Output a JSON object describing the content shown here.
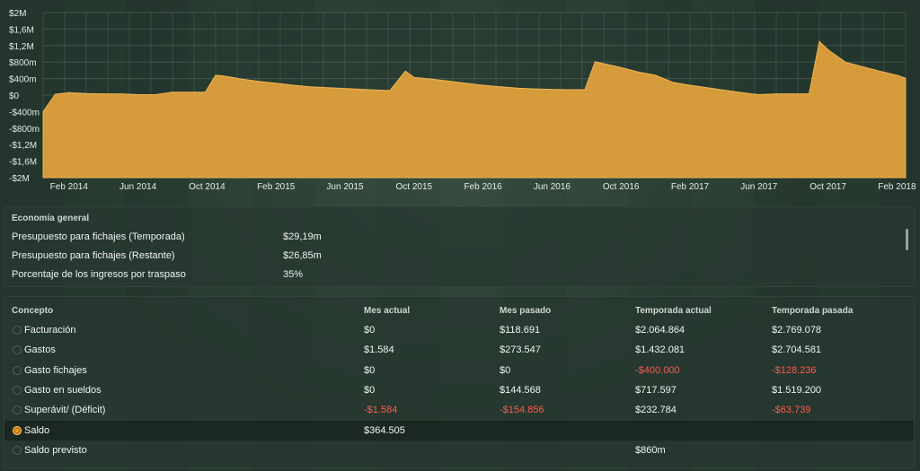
{
  "chart_data": {
    "type": "area",
    "y_ticks": [
      "$2M",
      "$1,6M",
      "$1,2M",
      "$800m",
      "$400m",
      "$0",
      "-$400m",
      "-$800m",
      "-$1,2M",
      "-$1,6M",
      "-$2M"
    ],
    "ylim": [
      -2000000,
      2000000
    ],
    "x_tick_labels": [
      "Feb 2014",
      "Jun 2014",
      "Oct 2014",
      "Feb 2015",
      "Jun 2015",
      "Oct 2015",
      "Feb 2016",
      "Jun 2016",
      "Oct 2016",
      "Feb 2017",
      "Jun 2017",
      "Oct 2017",
      "Feb 2018"
    ],
    "x_tick_months": [
      1,
      5,
      9,
      13,
      17,
      21,
      25,
      29,
      33,
      37,
      41,
      45,
      49
    ],
    "x_range_months": [
      -0.5,
      49.5
    ],
    "grid": true,
    "fill_color": "#e3a23c",
    "x_months": [
      -0.5,
      0.2,
      1,
      2,
      3,
      4,
      5,
      6,
      7,
      8,
      8.9,
      9.5,
      10,
      11,
      12,
      13,
      14,
      15,
      16,
      17,
      18,
      19,
      19.6,
      20.5,
      21,
      22,
      23,
      24,
      25,
      26,
      27,
      28,
      29,
      30,
      30.9,
      31.5,
      32,
      33,
      34,
      35,
      36,
      37,
      38,
      39,
      40,
      41,
      42,
      43,
      43.9,
      44.5,
      45,
      46,
      47,
      48,
      49,
      49.5
    ],
    "values": [
      -400000,
      20000,
      60000,
      40000,
      30000,
      30000,
      10000,
      10000,
      70000,
      70000,
      70000,
      480000,
      460000,
      390000,
      330000,
      290000,
      240000,
      200000,
      180000,
      160000,
      140000,
      120000,
      110000,
      580000,
      430000,
      390000,
      340000,
      290000,
      240000,
      200000,
      170000,
      150000,
      140000,
      130000,
      130000,
      810000,
      760000,
      670000,
      560000,
      480000,
      310000,
      240000,
      180000,
      120000,
      60000,
      10000,
      30000,
      30000,
      30000,
      1300000,
      1100000,
      800000,
      690000,
      580000,
      480000,
      410000
    ]
  },
  "economy": {
    "title": "Economía general",
    "rows": [
      {
        "label": "Presupuesto para fichajes (Temporada)",
        "value": "$29,19m"
      },
      {
        "label": "Presupuesto para fichajes (Restante)",
        "value": "$26,85m"
      },
      {
        "label": "Porcentaje de los ingresos por traspaso",
        "value": "35%"
      }
    ]
  },
  "finance": {
    "headers": {
      "concept": "Concepto",
      "current_month": "Mes actual",
      "last_month": "Mes pasado",
      "current_season": "Temporada actual",
      "last_season": "Temporada pasada"
    },
    "rows": [
      {
        "concept": "Facturación",
        "current_month": "$0",
        "last_month": "$118.691",
        "current_season": "$2.064.864",
        "last_season": "$2.769.078"
      },
      {
        "concept": "Gastos",
        "current_month": "$1.584",
        "last_month": "$273.547",
        "current_season": "$1.432.081",
        "last_season": "$2.704.581"
      },
      {
        "concept": "Gasto fichajes",
        "current_month": "$0",
        "last_month": "$0",
        "current_season": "-$400.000",
        "last_season": "-$128.236"
      },
      {
        "concept": "Gasto en sueldos",
        "current_month": "$0",
        "last_month": "$144.568",
        "current_season": "$717.597",
        "last_season": "$1.519.200"
      },
      {
        "concept": "Superávit/ (Déficit)",
        "current_month": "-$1.584",
        "last_month": "-$154.856",
        "current_season": "$232.784",
        "last_season": "-$63.739"
      },
      {
        "concept": "Saldo",
        "current_month": "$364.505",
        "last_month": "",
        "current_season": "",
        "last_season": ""
      },
      {
        "concept": "Saldo previsto",
        "current_month": "",
        "last_month": "",
        "current_season": "$860m",
        "last_season": ""
      }
    ],
    "selected_row": "Saldo",
    "negative_color": "#ff5a4e"
  }
}
